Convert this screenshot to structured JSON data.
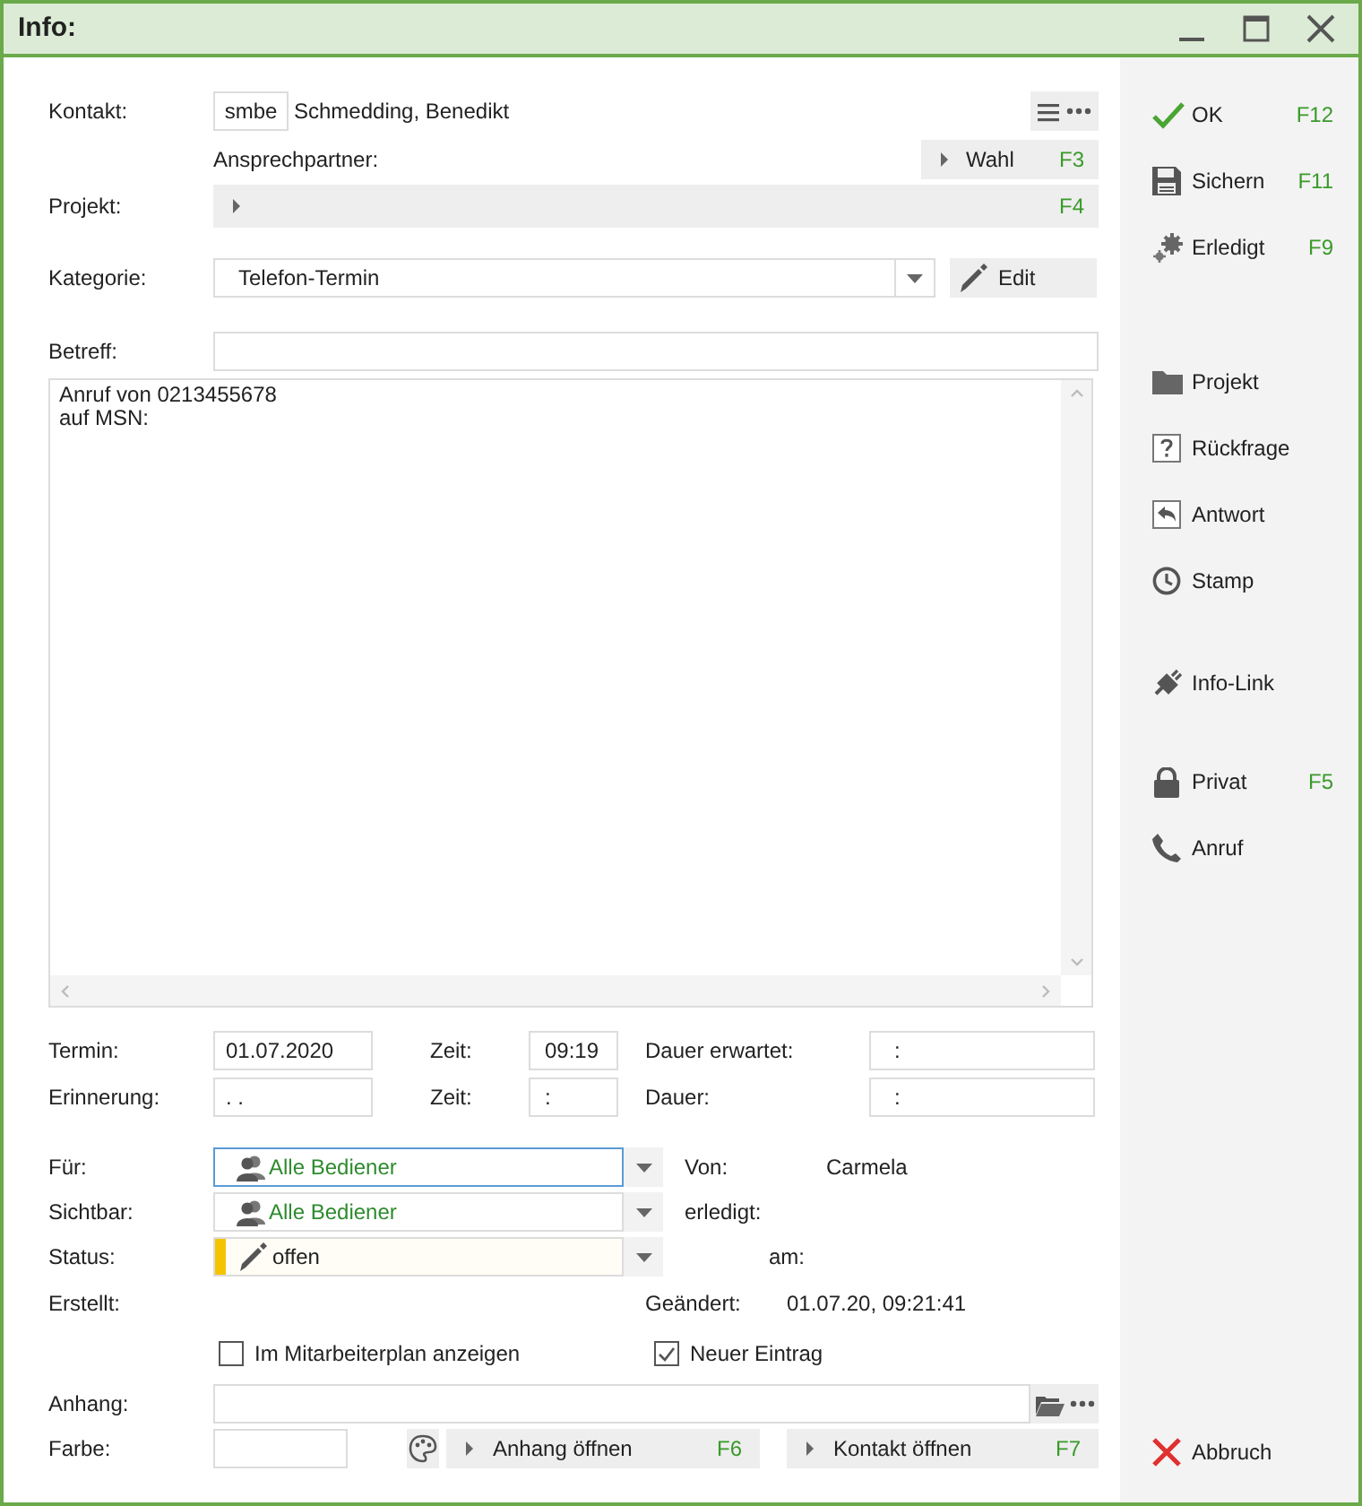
{
  "window": {
    "title": "Info:"
  },
  "form": {
    "contact": {
      "label": "Kontakt:",
      "code": "smbe",
      "name": "Schmedding, Benedikt"
    },
    "contact_person": {
      "label": "Ansprechpartner:"
    },
    "choose_button": {
      "label": "Wahl",
      "key": "F3"
    },
    "project": {
      "label": "Projekt:",
      "key": "F4"
    },
    "category": {
      "label": "Kategorie:",
      "value": "Telefon-Termin"
    },
    "edit_button": {
      "label": "Edit"
    },
    "subject": {
      "label": "Betreff:"
    },
    "notes": {
      "lines": [
        "Anruf von 0213455678",
        "auf MSN:"
      ]
    },
    "appointment": {
      "label": "Termin:",
      "date": "01.07.2020",
      "time_label": "Zeit:",
      "time": "09:19",
      "duration_label": "Dauer erwartet:",
      "duration": ":"
    },
    "reminder": {
      "label": "Erinnerung:",
      "date": ". .",
      "time_label": "Zeit:",
      "time": ":",
      "duration_label": "Dauer:",
      "duration": ":"
    },
    "assigned_to": {
      "label": "Für:",
      "value": "Alle Bediener",
      "focused": true
    },
    "from": {
      "label": "Von:",
      "value": "Carmela"
    },
    "visible_to": {
      "label": "Sichtbar:",
      "value": "Alle Bediener",
      "focused": false
    },
    "done": {
      "label": "erledigt:"
    },
    "status": {
      "label": "Status:",
      "value": "offen"
    },
    "done_at": {
      "label": "am:"
    },
    "created": {
      "label": "Erstellt:"
    },
    "changed": {
      "label": "Geändert:",
      "value": "01.07.20, 09:21:41"
    },
    "checkboxes": [
      {
        "label": "Im Mitarbeiterplan anzeigen",
        "checked": false
      },
      {
        "label": "Neuer Eintrag",
        "checked": true
      }
    ],
    "attachment": {
      "label": "Anhang:"
    },
    "color_field": {
      "label": "Farbe:"
    },
    "open_buttons": [
      {
        "label": "Anhang öffnen",
        "key": "F6"
      },
      {
        "label": "Kontakt öffnen",
        "key": "F7"
      }
    ]
  },
  "sidebar": {
    "groups": [
      [
        {
          "label": "OK",
          "key": "F12"
        },
        {
          "label": "Sichern",
          "key": "F11"
        },
        {
          "label": "Erledigt",
          "key": "F9"
        }
      ],
      [
        {
          "label": "Projekt"
        },
        {
          "label": "Rückfrage"
        },
        {
          "label": "Antwort"
        },
        {
          "label": "Stamp"
        }
      ],
      [
        {
          "label": "Info-Link"
        }
      ],
      [
        {
          "label": "Privat",
          "key": "F5"
        },
        {
          "label": "Anruf"
        }
      ]
    ],
    "cancel": {
      "label": "Abbruch"
    }
  }
}
